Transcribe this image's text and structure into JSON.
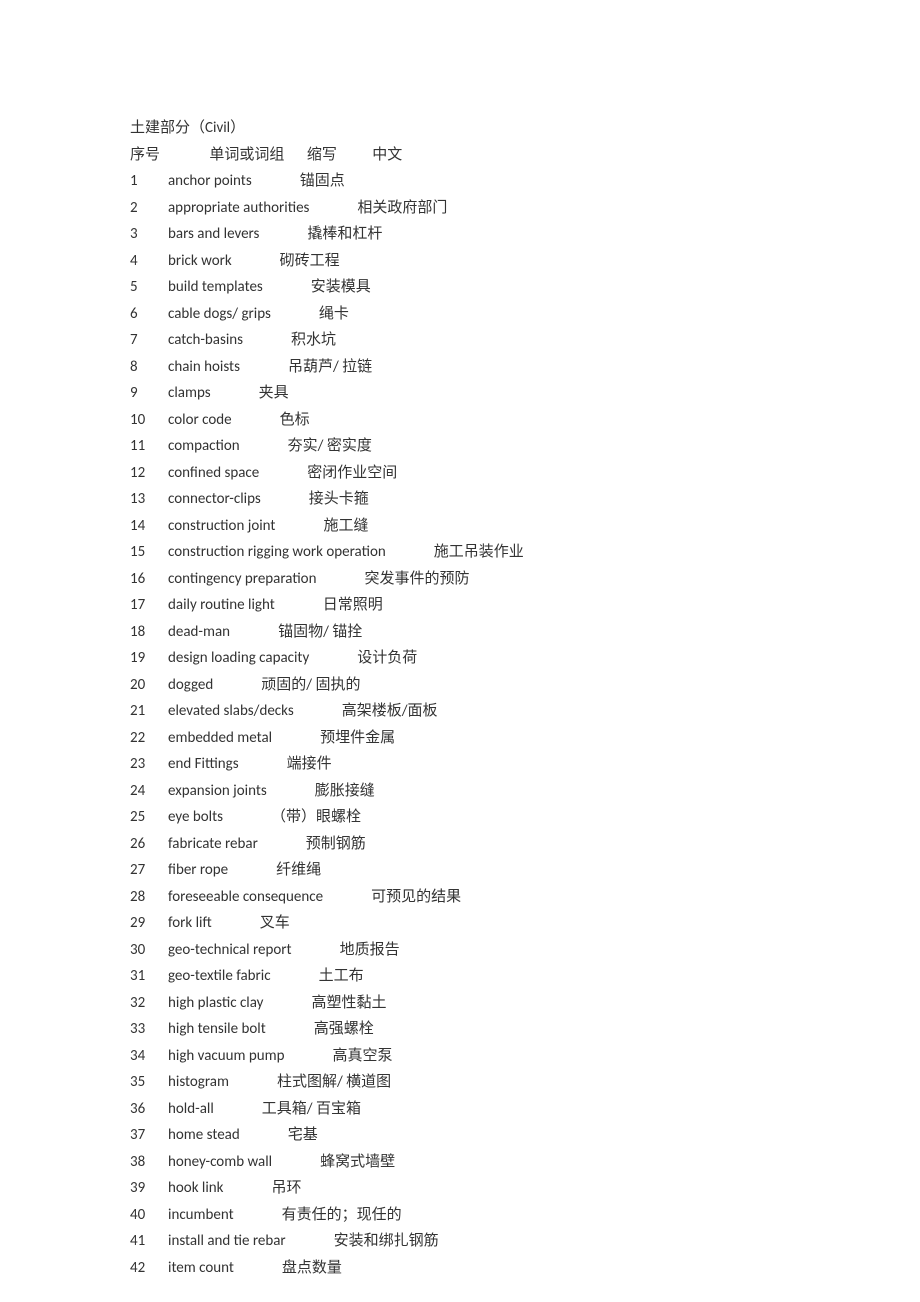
{
  "title": "土建部分（Civil）",
  "header": {
    "c1": "序号",
    "c2": "单词或词组",
    "c3": "缩写",
    "c4": "中文"
  },
  "rows": [
    {
      "n": "1",
      "term": "anchor points",
      "cn": "锚固点"
    },
    {
      "n": "2",
      "term": "appropriate authorities",
      "cn": "相关政府部门"
    },
    {
      "n": "3",
      "term": "bars and levers",
      "cn": "撬棒和杠杆"
    },
    {
      "n": "4",
      "term": "brick work",
      "cn": "砌砖工程"
    },
    {
      "n": "5",
      "term": "build templates",
      "cn": "安装模具"
    },
    {
      "n": "6",
      "term": "cable dogs/ grips",
      "cn": "绳卡"
    },
    {
      "n": "7",
      "term": "catch-basins",
      "cn": "积水坑"
    },
    {
      "n": "8",
      "term": "chain hoists",
      "cn": "吊葫芦/ 拉链"
    },
    {
      "n": "9",
      "term": "clamps",
      "cn": "夹具"
    },
    {
      "n": "10",
      "term": "color code",
      "cn": "色标"
    },
    {
      "n": "11",
      "term": "compaction",
      "cn": "夯实/ 密实度"
    },
    {
      "n": "12",
      "term": "confined space",
      "cn": "密闭作业空间"
    },
    {
      "n": "13",
      "term": "connector-clips",
      "cn": "接头卡箍"
    },
    {
      "n": "14",
      "term": "construction joint",
      "cn": "施工缝"
    },
    {
      "n": "15",
      "term": "construction rigging work operation",
      "cn": "施工吊装作业"
    },
    {
      "n": "16",
      "term": "contingency preparation",
      "cn": "突发事件的预防"
    },
    {
      "n": "17",
      "term": "daily routine light",
      "cn": "日常照明"
    },
    {
      "n": "18",
      "term": "dead-man",
      "cn": "锚固物/ 锚拴"
    },
    {
      "n": "19",
      "term": "design loading capacity",
      "cn": "设计负荷"
    },
    {
      "n": "20",
      "term": "dogged",
      "cn": "顽固的/ 固执的"
    },
    {
      "n": "21",
      "term": "elevated slabs/decks",
      "cn": "高架楼板/面板"
    },
    {
      "n": "22",
      "term": "embedded metal",
      "cn": "预埋件金属"
    },
    {
      "n": "23",
      "term": "end Fittings",
      "cn": "端接件"
    },
    {
      "n": "24",
      "term": "expansion joints",
      "cn": "膨胀接缝"
    },
    {
      "n": "25",
      "term": "eye bolts",
      "cn": "（带）眼螺栓"
    },
    {
      "n": "26",
      "term": "fabricate rebar",
      "cn": "预制钢筋"
    },
    {
      "n": "27",
      "term": "fiber rope",
      "cn": "纤维绳"
    },
    {
      "n": "28",
      "term": "foreseeable consequence",
      "cn": "可预见的结果"
    },
    {
      "n": "29",
      "term": "fork lift",
      "cn": "叉车"
    },
    {
      "n": "30",
      "term": "geo-technical report",
      "cn": "地质报告"
    },
    {
      "n": "31",
      "term": "geo-textile fabric",
      "cn": "土工布"
    },
    {
      "n": "32",
      "term": "high plastic clay",
      "cn": "高塑性黏土"
    },
    {
      "n": "33",
      "term": "high tensile bolt",
      "cn": "高强螺栓"
    },
    {
      "n": "34",
      "term": "high vacuum pump",
      "cn": "高真空泵"
    },
    {
      "n": "35",
      "term": "histogram",
      "cn": "柱式图解/ 横道图"
    },
    {
      "n": "36",
      "term": "hold-all",
      "cn": "工具箱/ 百宝箱"
    },
    {
      "n": "37",
      "term": "home stead",
      "cn": "宅基"
    },
    {
      "n": "38",
      "term": "honey-comb wall",
      "cn": "蜂窝式墙壁"
    },
    {
      "n": "39",
      "term": "hook link",
      "cn": "吊环"
    },
    {
      "n": "40",
      "term": "incumbent",
      "cn": "有责任的；现任的"
    },
    {
      "n": "41",
      "term": "install and tie rebar",
      "cn": "安装和绑扎钢筋"
    },
    {
      "n": "42",
      "term": "item count",
      "cn": "盘点数量"
    }
  ]
}
